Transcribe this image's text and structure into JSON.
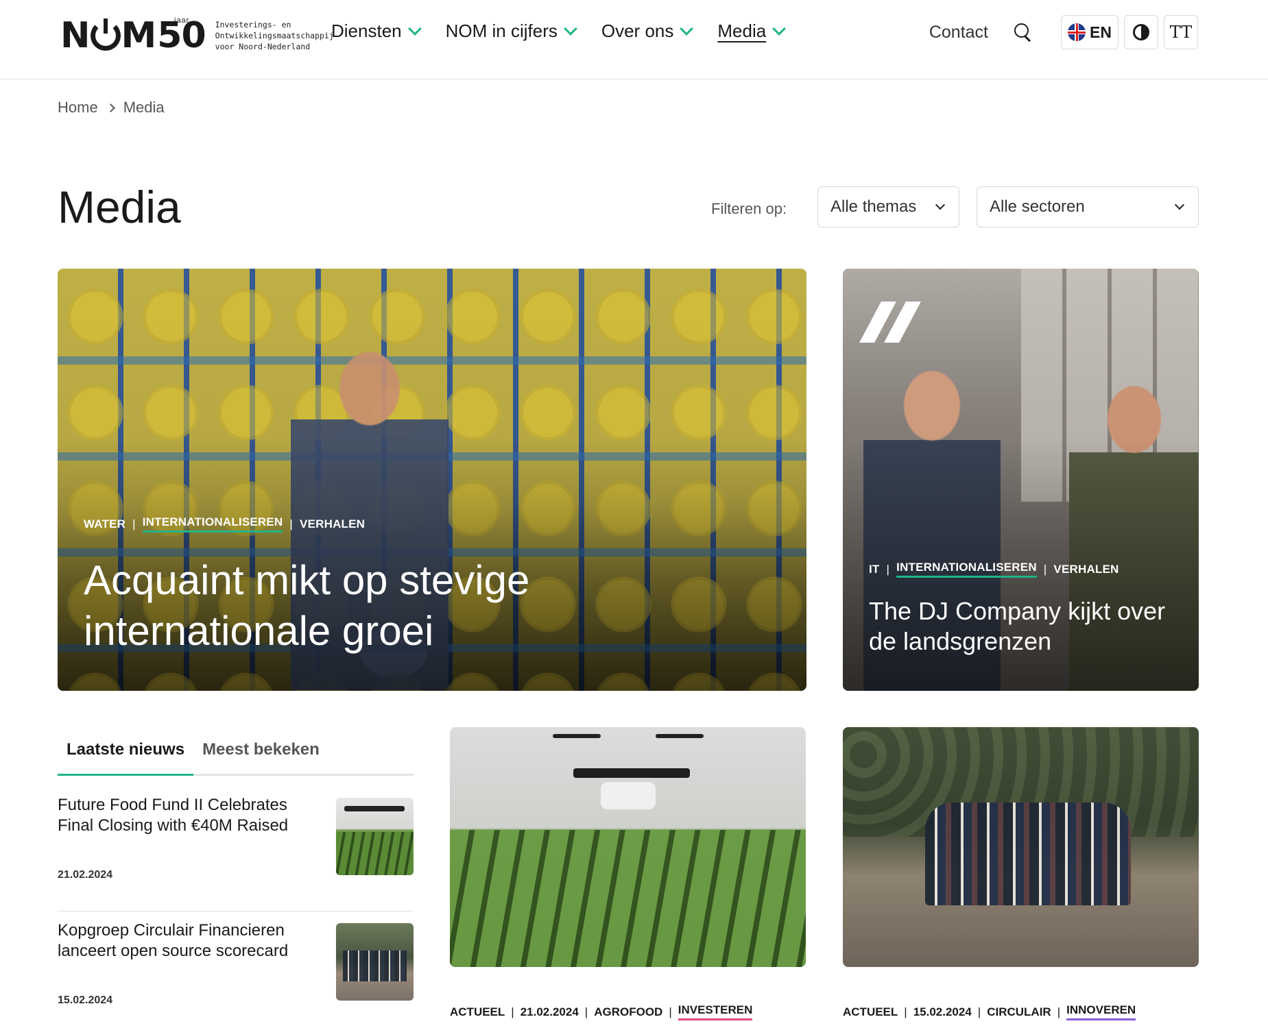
{
  "header": {
    "logo": {
      "word": "NOM",
      "number": "50",
      "jaar": "jaar",
      "tagline": "Investerings- en Ontwikkelingsmaatschappij voor Noord-Nederland"
    },
    "nav": [
      {
        "label": "Diensten"
      },
      {
        "label": "NOM in cijfers"
      },
      {
        "label": "Over ons"
      },
      {
        "label": "Media"
      }
    ],
    "contact": "Contact",
    "language": "EN",
    "text_size": "TT"
  },
  "breadcrumb": {
    "home": "Home",
    "current": "Media"
  },
  "page": {
    "title": "Media"
  },
  "filters": {
    "label": "Filteren op:",
    "themes": "Alle themas",
    "sectors": "Alle sectoren"
  },
  "hero_main": {
    "tags": [
      "WATER",
      "INTERNATIONALISEREN",
      "VERHALEN"
    ],
    "title": "Acquaint mikt op stevige internationale groei"
  },
  "hero_side": {
    "tags": [
      "IT",
      "INTERNATIONALISEREN",
      "VERHALEN"
    ],
    "title": "The DJ Company kijkt over de landsgrenzen"
  },
  "news": {
    "tabs": [
      "Laatste nieuws",
      "Meest bekeken"
    ],
    "items": [
      {
        "title": "Future Food Fund II Celebrates Final Closing with €40M Raised",
        "date": "21.02.2024"
      },
      {
        "title": "Kopgroep Circulair Financieren lanceert open source scorecard",
        "date": "15.02.2024"
      }
    ]
  },
  "grid": [
    {
      "tags": [
        "ACTUEEL",
        "21.02.2024",
        "AGROFOOD",
        "INVESTEREN"
      ]
    },
    {
      "tags": [
        "ACTUEEL",
        "15.02.2024",
        "CIRCULAIR",
        "INNOVEREN"
      ]
    }
  ],
  "colors": {
    "accent": "#20b489",
    "pink": "#e34b7a",
    "purple": "#8a5ed8"
  }
}
